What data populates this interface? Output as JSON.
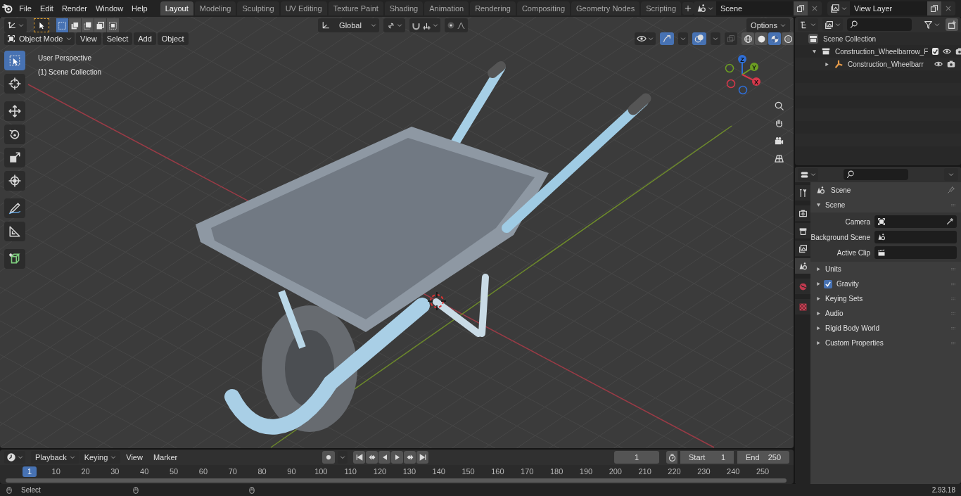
{
  "top_bar": {
    "menus": [
      "File",
      "Edit",
      "Render",
      "Window",
      "Help"
    ],
    "workspaces": [
      {
        "label": "Layout",
        "selected": true
      },
      {
        "label": "Modeling",
        "selected": false
      },
      {
        "label": "Sculpting",
        "selected": false
      },
      {
        "label": "UV Editing",
        "selected": false
      },
      {
        "label": "Texture Paint",
        "selected": false
      },
      {
        "label": "Shading",
        "selected": false
      },
      {
        "label": "Animation",
        "selected": false
      },
      {
        "label": "Rendering",
        "selected": false
      },
      {
        "label": "Compositing",
        "selected": false
      },
      {
        "label": "Geometry Nodes",
        "selected": false
      },
      {
        "label": "Scripting",
        "selected": false
      }
    ],
    "scene": "Scene",
    "view_layer": "View Layer"
  },
  "viewport": {
    "orientation": "Global",
    "options": "Options",
    "mode": "Object Mode",
    "menus": [
      "View",
      "Select",
      "Add",
      "Object"
    ],
    "select_modes": [
      {
        "kind": "new",
        "selected": true
      },
      {
        "kind": "extend",
        "selected": false
      },
      {
        "kind": "subtract",
        "selected": false
      },
      {
        "kind": "invert",
        "selected": false
      },
      {
        "kind": "intersect",
        "selected": false
      }
    ],
    "tools": [
      {
        "kind": "select",
        "selected": true
      },
      {
        "kind": "cursor",
        "selected": false
      },
      {
        "kind": "move",
        "selected": false
      },
      {
        "kind": "rotate",
        "selected": false
      },
      {
        "kind": "scale",
        "selected": false
      },
      {
        "kind": "transform",
        "selected": false
      },
      {
        "kind": "annotate",
        "selected": false
      },
      {
        "kind": "measure",
        "selected": false
      },
      {
        "kind": "add_cube",
        "selected": false
      }
    ],
    "shading_modes": [
      {
        "kind": "wireframe",
        "selected": false
      },
      {
        "kind": "solid",
        "selected": false
      },
      {
        "kind": "material",
        "selected": true
      },
      {
        "kind": "rendered",
        "selected": false
      }
    ],
    "view_name": "User Perspective",
    "collection": "(1) Scene Collection",
    "gizmo_axes": [
      {
        "label": "Z",
        "color": "#2f6fd8"
      },
      {
        "label": "Y",
        "color": "#6c9e22"
      },
      {
        "label": "X",
        "color": "#d7384b"
      }
    ]
  },
  "outliner": {
    "root": "Scene Collection",
    "items": [
      {
        "label": "Construction_Wheelbarrow_F",
        "expanded": true,
        "checked": true,
        "children": [
          {
            "label": "Construction_Wheelbarr",
            "expanded": false
          }
        ]
      }
    ]
  },
  "properties": {
    "tabs": [
      {
        "kind": "tool",
        "selected": false
      },
      {
        "kind": "render",
        "selected": false
      },
      {
        "kind": "output",
        "selected": false
      },
      {
        "kind": "view_layer",
        "selected": false
      },
      {
        "kind": "scene",
        "selected": true
      },
      {
        "kind": "world",
        "selected": false
      },
      {
        "kind": "texture",
        "selected": false
      }
    ],
    "context": "Scene",
    "panels": [
      {
        "title": "Scene",
        "kind": "plain",
        "expanded": true,
        "fields": [
          {
            "label": "Camera",
            "kind": "camera"
          },
          {
            "label": "Background Scene",
            "kind": "scene"
          },
          {
            "label": "Active Clip",
            "kind": "clip"
          }
        ]
      },
      {
        "title": "Units",
        "kind": "plain",
        "expanded": false
      },
      {
        "title": "Gravity",
        "kind": "checkbox",
        "checked": true,
        "expanded": false
      },
      {
        "title": "Keying Sets",
        "kind": "plain",
        "expanded": false
      },
      {
        "title": "Audio",
        "kind": "plain",
        "expanded": false
      },
      {
        "title": "Rigid Body World",
        "kind": "plain",
        "expanded": false
      },
      {
        "title": "Custom Properties",
        "kind": "plain",
        "expanded": false
      }
    ]
  },
  "timeline": {
    "menus": [
      {
        "label": "Playback",
        "kind": "dropdown"
      },
      {
        "label": "Keying",
        "kind": "dropdown"
      },
      {
        "label": "View",
        "kind": "menu"
      },
      {
        "label": "Marker",
        "kind": "menu"
      }
    ],
    "current_frame": "1",
    "start_label": "Start",
    "start": "1",
    "end_label": "End",
    "end": "250",
    "ticks": [
      {
        "label": "1",
        "selected": true
      },
      {
        "label": "10",
        "selected": false
      },
      {
        "label": "20",
        "selected": false
      },
      {
        "label": "30",
        "selected": false
      },
      {
        "label": "40",
        "selected": false
      },
      {
        "label": "50",
        "selected": false
      },
      {
        "label": "60",
        "selected": false
      },
      {
        "label": "70",
        "selected": false
      },
      {
        "label": "80",
        "selected": false
      },
      {
        "label": "90",
        "selected": false
      },
      {
        "label": "100",
        "selected": false
      },
      {
        "label": "110",
        "selected": false
      },
      {
        "label": "120",
        "selected": false
      },
      {
        "label": "130",
        "selected": false
      },
      {
        "label": "140",
        "selected": false
      },
      {
        "label": "150",
        "selected": false
      },
      {
        "label": "160",
        "selected": false
      },
      {
        "label": "170",
        "selected": false
      },
      {
        "label": "180",
        "selected": false
      },
      {
        "label": "190",
        "selected": false
      },
      {
        "label": "200",
        "selected": false
      },
      {
        "label": "210",
        "selected": false
      },
      {
        "label": "220",
        "selected": false
      },
      {
        "label": "230",
        "selected": false
      },
      {
        "label": "240",
        "selected": false
      },
      {
        "label": "250",
        "selected": false
      }
    ]
  },
  "status_bar": {
    "hint": "Select",
    "version": "2.93.18"
  }
}
